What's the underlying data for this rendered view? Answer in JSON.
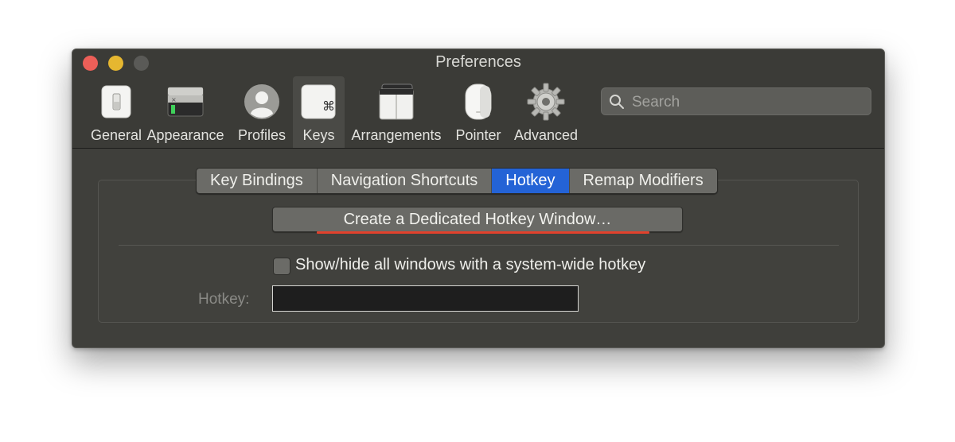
{
  "window": {
    "title": "Preferences"
  },
  "toolbar": {
    "items": [
      {
        "label": "General",
        "icon": "general-icon"
      },
      {
        "label": "Appearance",
        "icon": "appearance-icon"
      },
      {
        "label": "Profiles",
        "icon": "profiles-icon"
      },
      {
        "label": "Keys",
        "icon": "keys-icon",
        "selected": true
      },
      {
        "label": "Arrangements",
        "icon": "arrangements-icon"
      },
      {
        "label": "Pointer",
        "icon": "pointer-icon"
      },
      {
        "label": "Advanced",
        "icon": "advanced-icon"
      }
    ],
    "keys_glyph": "⌘"
  },
  "search": {
    "placeholder": "Search",
    "value": ""
  },
  "tabs": [
    {
      "label": "Key Bindings",
      "active": false
    },
    {
      "label": "Navigation Shortcuts",
      "active": false
    },
    {
      "label": "Hotkey",
      "active": true
    },
    {
      "label": "Remap Modifiers",
      "active": false
    }
  ],
  "hotkey_pane": {
    "create_button_label": "Create a Dedicated Hotkey Window…",
    "show_hide_checkbox_label": "Show/hide all windows with a system-wide hotkey",
    "show_hide_checked": false,
    "hotkey_label": "Hotkey:",
    "hotkey_value": ""
  },
  "colors": {
    "accent": "#2463d6",
    "annotation_underline": "#e2412c",
    "close": "#ed5f58",
    "minimize": "#e6b730"
  }
}
